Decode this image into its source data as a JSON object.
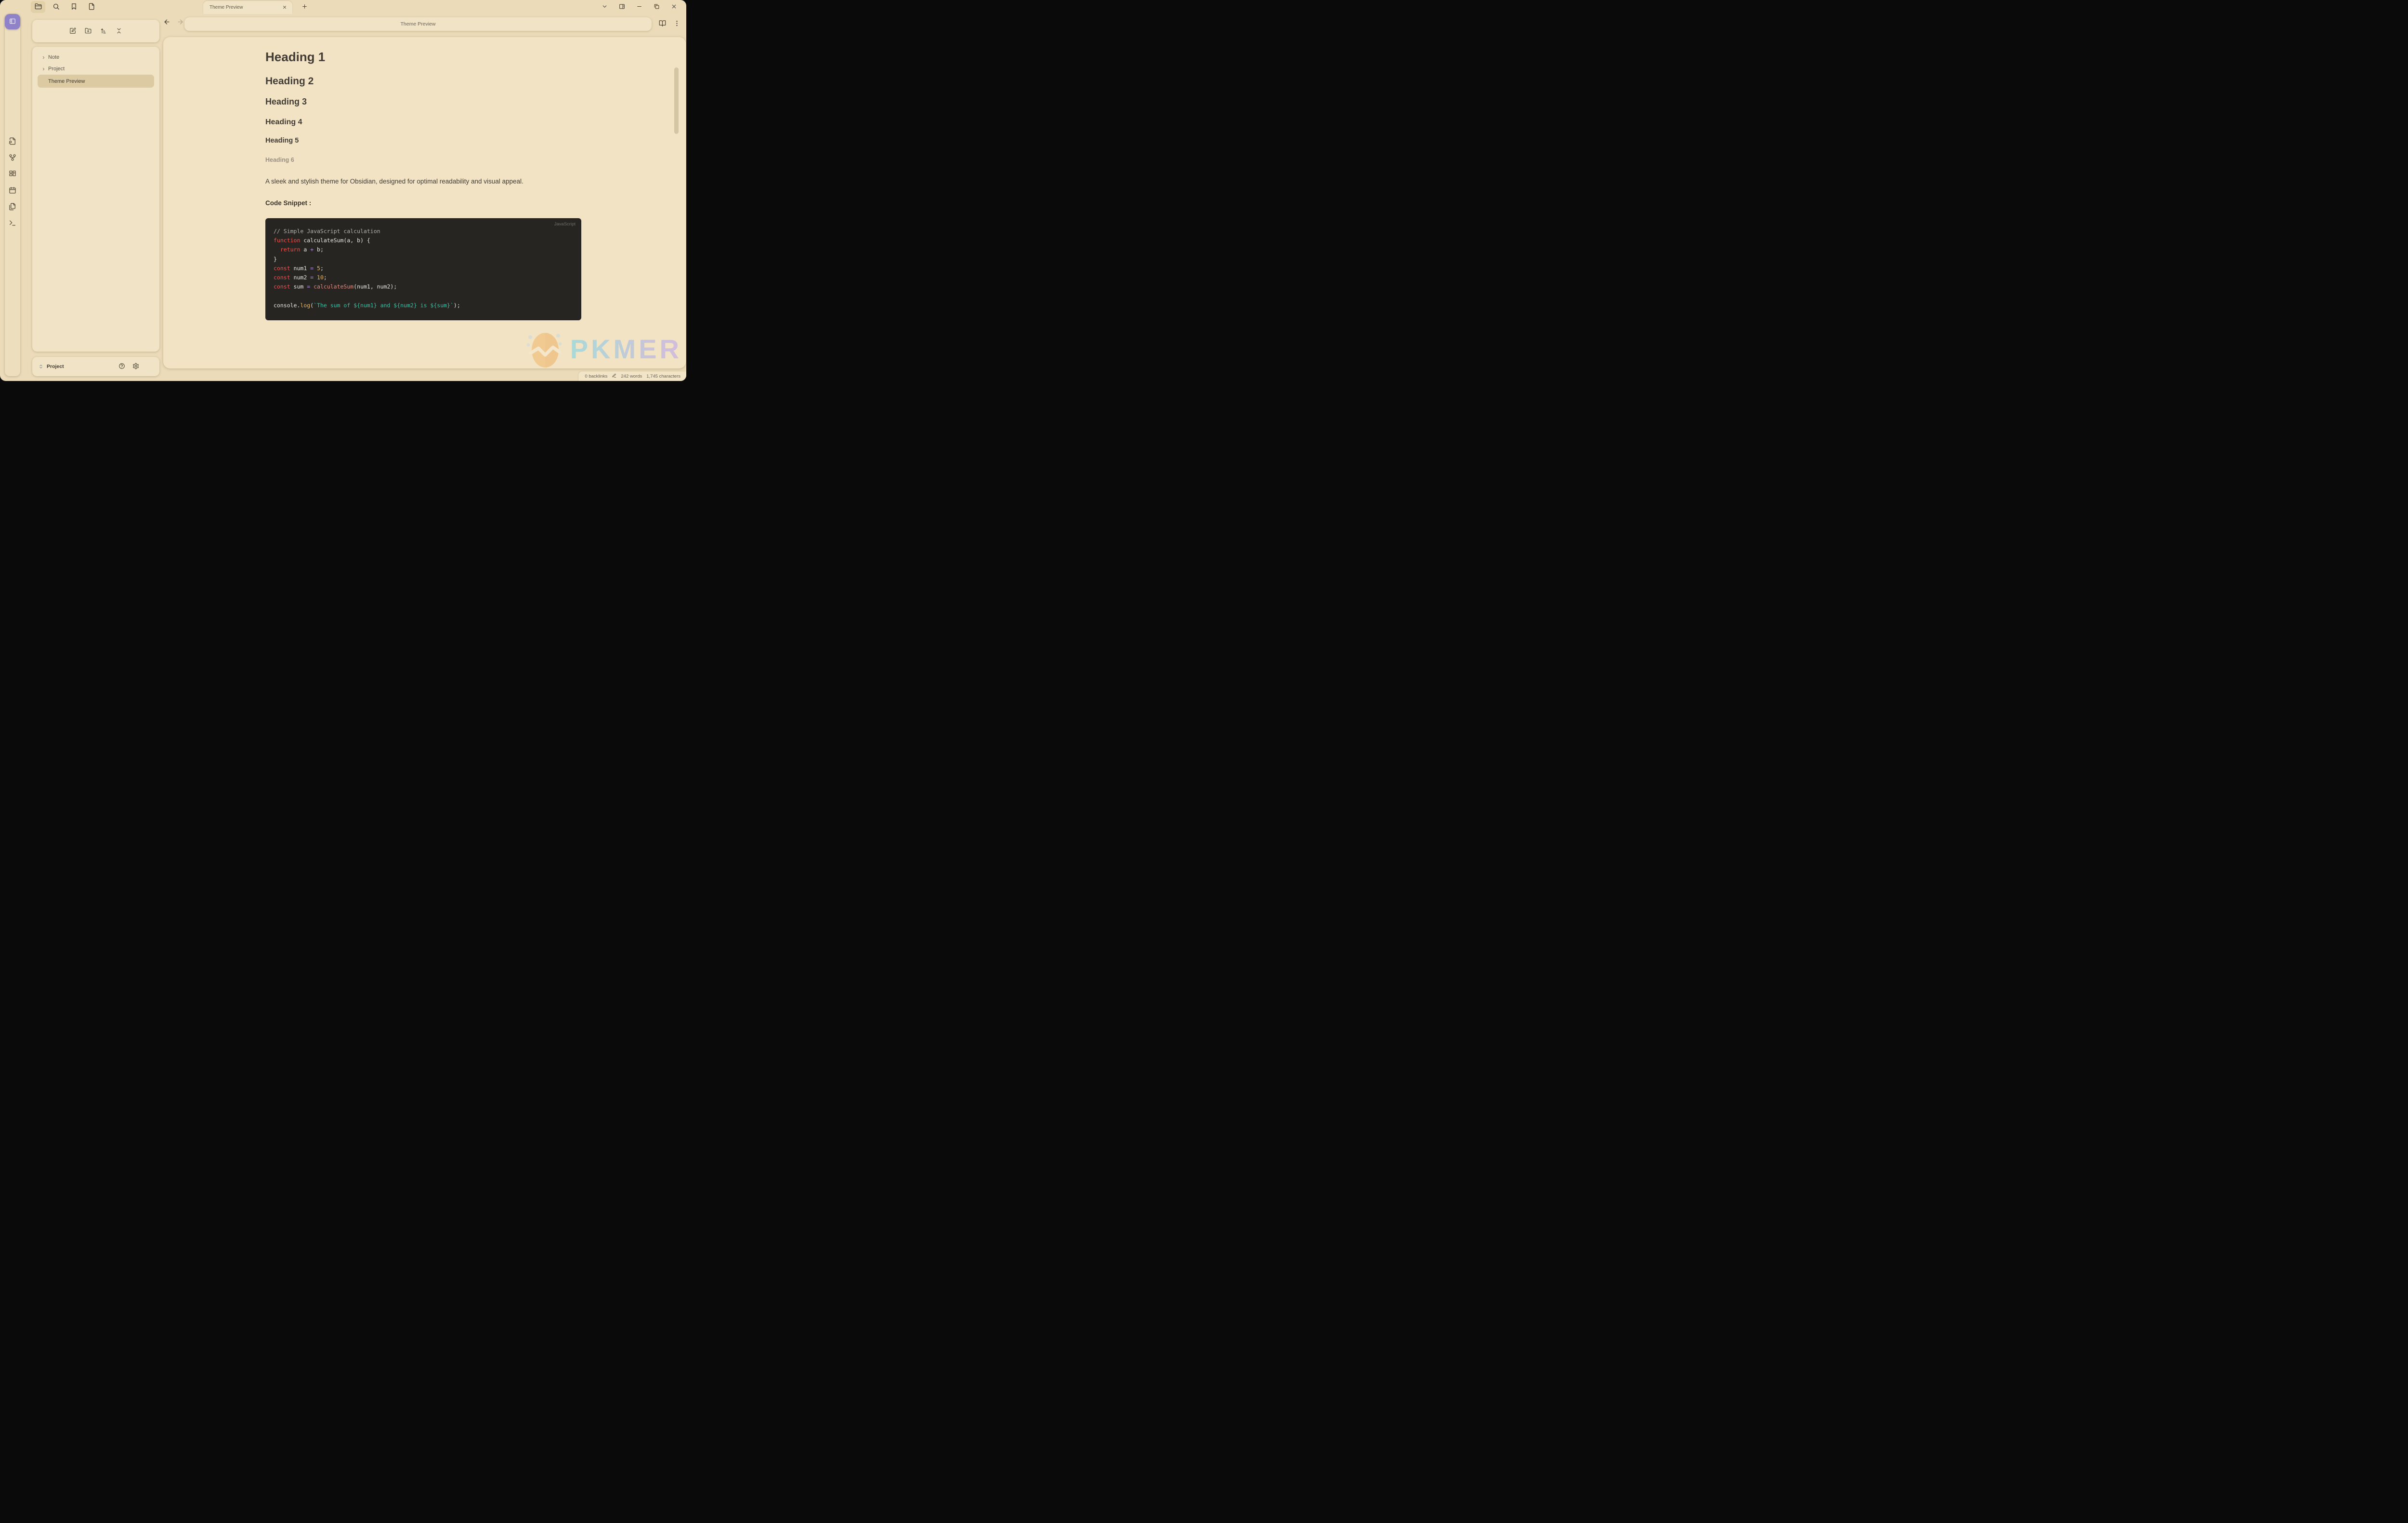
{
  "titlebar": {
    "toolbar_icons": [
      {
        "name": "folder",
        "active": true
      },
      {
        "name": "search",
        "active": false
      },
      {
        "name": "bookmark",
        "active": false
      },
      {
        "name": "file",
        "active": false
      }
    ],
    "tab": {
      "title": "Theme Preview"
    },
    "window_icons": [
      "chevron-down",
      "panel-right",
      "minimize",
      "restore",
      "close"
    ]
  },
  "ribbon": {
    "active_icon": "panel-left",
    "icons": [
      "file-search",
      "git-fork",
      "layout-dashboard",
      "calendar",
      "files",
      "terminal"
    ]
  },
  "explorer": {
    "action_icons": [
      "new-note",
      "new-folder",
      "sort-ascending",
      "collapse-all"
    ],
    "items": [
      {
        "label": "Note",
        "type": "folder",
        "selected": false
      },
      {
        "label": "Project",
        "type": "folder",
        "selected": false
      },
      {
        "label": "Theme Preview",
        "type": "file",
        "selected": true
      }
    ],
    "vault": {
      "name": "Project",
      "icons": [
        "chevrons-up-down",
        "help-circle",
        "settings-gear"
      ]
    }
  },
  "view": {
    "title": "Theme Preview",
    "icons": [
      "arrow-left",
      "arrow-right",
      "book-open",
      "more-vertical"
    ]
  },
  "content": {
    "headings": [
      "Heading 1",
      "Heading 2",
      "Heading 3",
      "Heading 4",
      "Heading 5",
      "Heading 6"
    ],
    "paragraph": "A sleek and stylish theme for Obsidian, designed for optimal readability and visual appeal.",
    "code_label": "Code Snippet :",
    "code": {
      "language": "JavaScript",
      "lines": [
        [
          {
            "t": "// Simple JavaScript calculation",
            "c": "comment"
          }
        ],
        [
          {
            "t": "function",
            "c": "kw"
          },
          {
            "t": " calculateSum(a, b) {",
            "c": "txt"
          }
        ],
        [
          {
            "t": "  ",
            "c": "txt"
          },
          {
            "t": "return",
            "c": "kw"
          },
          {
            "t": " a ",
            "c": "txt"
          },
          {
            "t": "+",
            "c": "op"
          },
          {
            "t": " b;",
            "c": "txt"
          }
        ],
        [
          {
            "t": "}",
            "c": "txt"
          }
        ],
        [
          {
            "t": "const",
            "c": "kw"
          },
          {
            "t": " num1 ",
            "c": "txt"
          },
          {
            "t": "=",
            "c": "op"
          },
          {
            "t": " ",
            "c": "txt"
          },
          {
            "t": "5",
            "c": "num"
          },
          {
            "t": ";",
            "c": "txt"
          }
        ],
        [
          {
            "t": "const",
            "c": "kw"
          },
          {
            "t": " num2 ",
            "c": "txt"
          },
          {
            "t": "=",
            "c": "op"
          },
          {
            "t": " ",
            "c": "txt"
          },
          {
            "t": "10",
            "c": "num"
          },
          {
            "t": ";",
            "c": "txt"
          }
        ],
        [
          {
            "t": "const",
            "c": "kw"
          },
          {
            "t": " sum ",
            "c": "txt"
          },
          {
            "t": "=",
            "c": "op"
          },
          {
            "t": " ",
            "c": "txt"
          },
          {
            "t": "calculateSum",
            "c": "call"
          },
          {
            "t": "(num1, num2);",
            "c": "txt"
          }
        ],
        [],
        [
          {
            "t": "console.",
            "c": "txt"
          },
          {
            "t": "log",
            "c": "num"
          },
          {
            "t": "(",
            "c": "txt"
          },
          {
            "t": "`The sum of ${num1} and ${num2} is ${sum}`",
            "c": "str"
          },
          {
            "t": ");",
            "c": "txt"
          }
        ]
      ]
    }
  },
  "watermark": {
    "text": "PKMER"
  },
  "status": {
    "backlinks": "0 backlinks",
    "words": "242 words",
    "characters": "1,745 characters"
  },
  "colors": {
    "accent_purple": "#8f82c8",
    "window_background": "#ebdbb9",
    "panel_background": "#f1e3c5",
    "selected_item": "#dccaa3",
    "code_background": "#262522",
    "keyword": "#f0524f",
    "operator": "#b18ae0",
    "number": "#e5b567",
    "function_call": "#e0897e",
    "string": "#3bbfa4",
    "comment": "#b2b1aa",
    "code_text": "#e8e6e1"
  }
}
